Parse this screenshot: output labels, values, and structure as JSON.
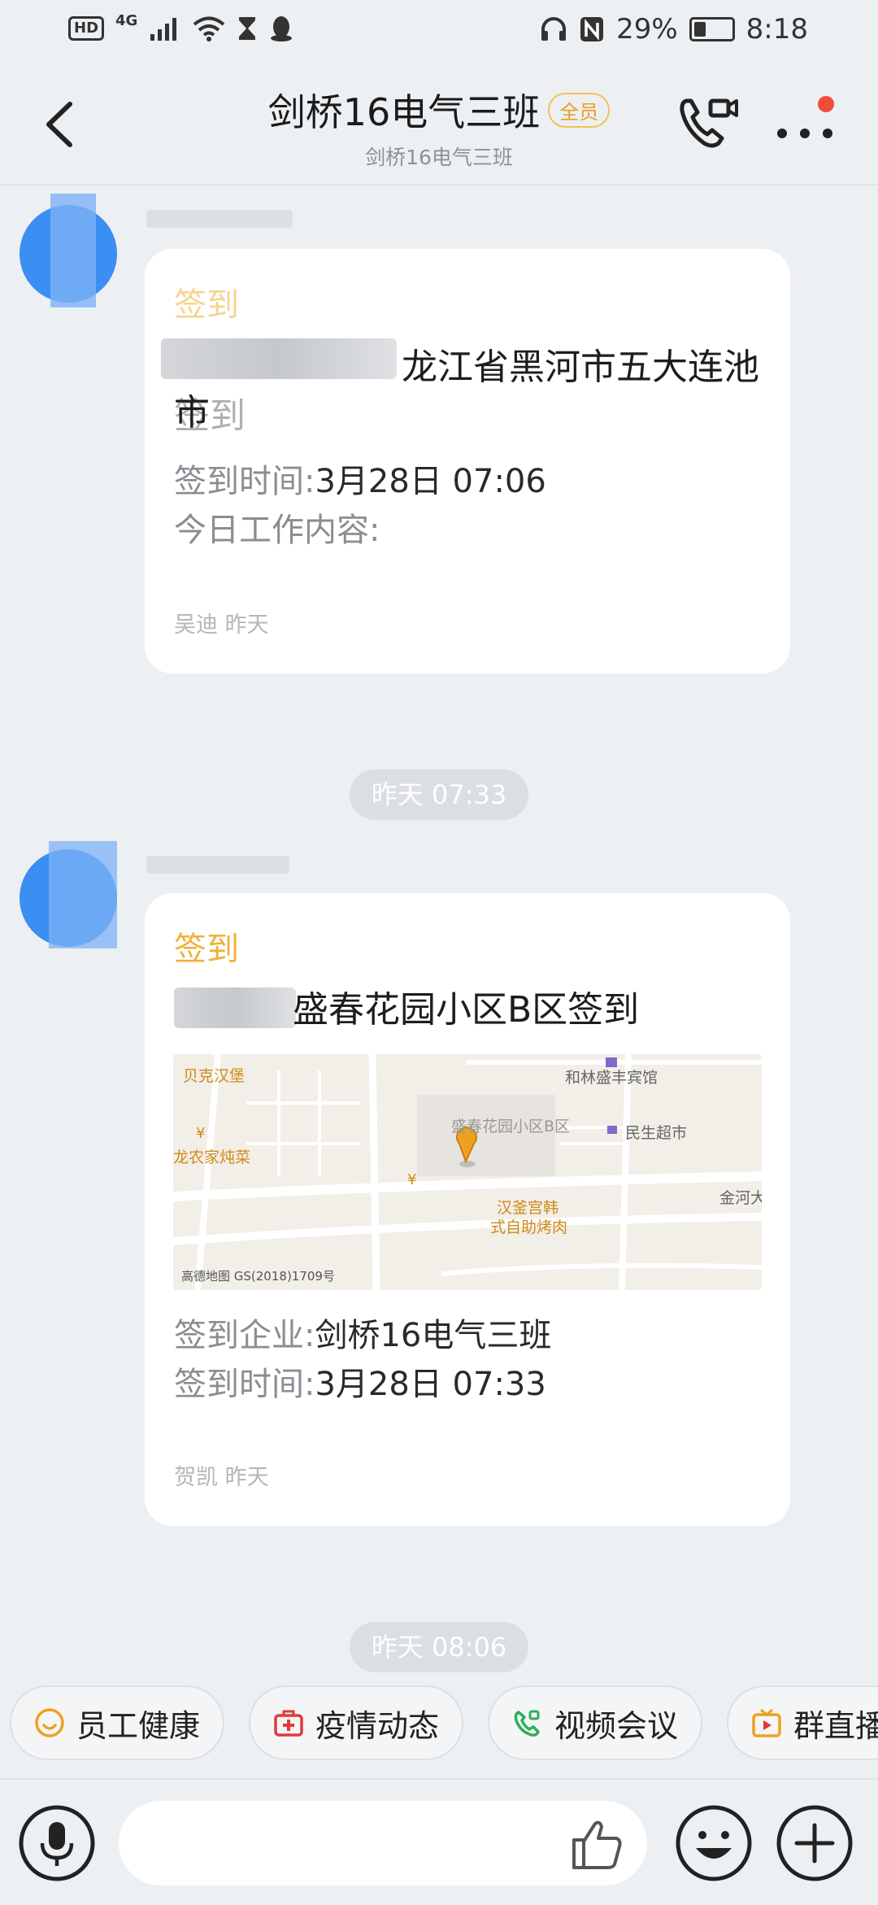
{
  "status_bar": {
    "network": "4G",
    "hd": "HD",
    "battery": "29%",
    "time": "8:18"
  },
  "header": {
    "title": "剑桥16电气三班",
    "badge": "全员",
    "subtitle": "剑桥16电气三班",
    "icons": [
      "back-icon",
      "video-call-icon",
      "more-icon"
    ]
  },
  "messages": [
    {
      "type": "签到",
      "title_visible": "龙江省黑河市五大连池市",
      "title_line2": "签到",
      "lines": [
        {
          "label": "签到时间:",
          "value": "3月28日 07:06"
        },
        {
          "label": "今日工作内容:",
          "value": ""
        }
      ],
      "footer_name": "吴迪",
      "footer_time": "昨天"
    },
    {
      "divider_time": "昨天 07:33",
      "type": "签到",
      "title_visible": "盛春花园小区B区签到",
      "map": {
        "labels": [
          "贝克汉堡",
          "和林盛丰宾馆",
          "盛春花园小区B区",
          "民生超市",
          "龙农家炖菜",
          "汉釜宫韩",
          "式自助烤肉",
          "金河大"
        ],
        "watermark": "高德地图 GS(2018)1709号"
      },
      "lines": [
        {
          "label": "签到企业:",
          "value": "剑桥16电气三班"
        },
        {
          "label": "签到时间:",
          "value": "3月28日 07:33"
        }
      ],
      "footer_name": "贺凯",
      "footer_time": "昨天"
    }
  ],
  "next_divider_time": "昨天 08:06",
  "quick_actions": [
    {
      "label": "员工健康",
      "icon": "smile-heart-icon",
      "color": "#f0a020"
    },
    {
      "label": "疫情动态",
      "icon": "medical-kit-icon",
      "color": "#e03a3a"
    },
    {
      "label": "视频会议",
      "icon": "video-phone-icon",
      "color": "#2fae5a"
    },
    {
      "label": "群直播",
      "icon": "tv-icon",
      "color": "#f0a020"
    }
  ],
  "input_bar": {
    "icons": [
      "voice-icon",
      "thumbs-up-icon",
      "emoji-icon",
      "plus-icon"
    ]
  }
}
